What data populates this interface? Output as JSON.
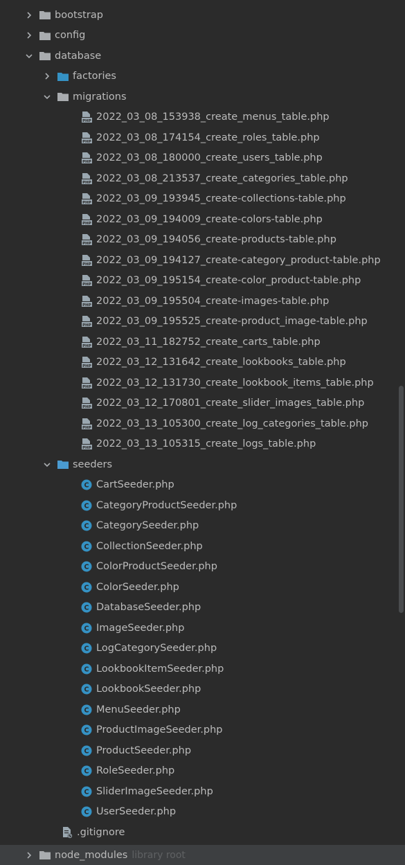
{
  "top_folders": [
    {
      "name": "bootstrap",
      "expanded": false
    },
    {
      "name": "config",
      "expanded": false
    },
    {
      "name": "database",
      "expanded": true
    }
  ],
  "database_children": {
    "factories": {
      "name": "factories",
      "expanded": false
    },
    "migrations": {
      "name": "migrations",
      "expanded": true
    },
    "seeders": {
      "name": "seeders",
      "expanded": true
    }
  },
  "migrations": [
    "2022_03_08_153938_create_menus_table.php",
    "2022_03_08_174154_create_roles_table.php",
    "2022_03_08_180000_create_users_table.php",
    "2022_03_08_213537_create_categories_table.php",
    "2022_03_09_193945_create-collections-table.php",
    "2022_03_09_194009_create-colors-table.php",
    "2022_03_09_194056_create-products-table.php",
    "2022_03_09_194127_create-category_product-table.php",
    "2022_03_09_195154_create-color_product-table.php",
    "2022_03_09_195504_create-images-table.php",
    "2022_03_09_195525_create-product_image-table.php",
    "2022_03_11_182752_create_carts_table.php",
    "2022_03_12_131642_create_lookbooks_table.php",
    "2022_03_12_131730_create_lookbook_items_table.php",
    "2022_03_12_170801_create_slider_images_table.php",
    "2022_03_13_105300_create_log_categories_table.php",
    "2022_03_13_105315_create_logs_table.php"
  ],
  "seeders": [
    "CartSeeder.php",
    "CategoryProductSeeder.php",
    "CategorySeeder.php",
    "CollectionSeeder.php",
    "ColorProductSeeder.php",
    "ColorSeeder.php",
    "DatabaseSeeder.php",
    "ImageSeeder.php",
    "LogCategorySeeder.php",
    "LookbookItemSeeder.php",
    "LookbookSeeder.php",
    "MenuSeeder.php",
    "ProductImageSeeder.php",
    "ProductSeeder.php",
    "RoleSeeder.php",
    "SliderImageSeeder.php",
    "UserSeeder.php"
  ],
  "gitignore": ".gitignore",
  "node_modules": {
    "name": "node_modules",
    "hint": "library root"
  },
  "colors": {
    "background": "#2b2b2b",
    "text": "#bbbbbb",
    "folder_gray": "#a9acaf",
    "folder_blue": "#3592c4",
    "folder_resource": "#4a9bd1",
    "class_icon": "#3592c4",
    "php_icon": "#9aa7b0",
    "selected_row": "#3d3f41",
    "muted_text": "#5f6163"
  }
}
